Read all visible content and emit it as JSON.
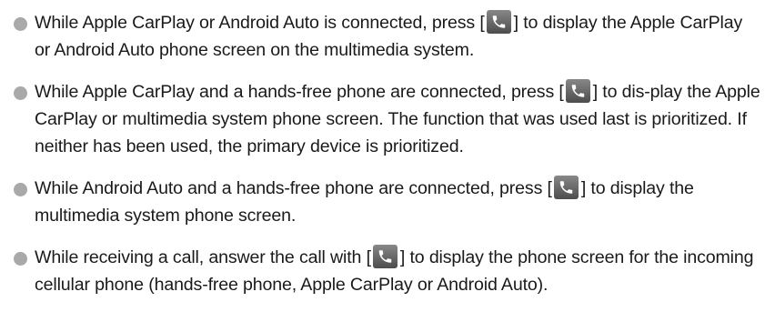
{
  "items": [
    {
      "before": "While Apple CarPlay or Android Auto is connected, press [",
      "after": "] to display the Apple CarPlay or Android Auto phone screen on the multimedia system."
    },
    {
      "before": "While Apple CarPlay and a hands-free phone are connected, press [",
      "after": "] to dis-play the Apple CarPlay or multimedia system phone screen. The function that was used last is prioritized. If neither has been used, the primary device is prioritized."
    },
    {
      "before": "While Android Auto and a hands-free phone are connected, press [",
      "after": "] to display the multimedia system phone screen."
    },
    {
      "before": "While receiving a call, answer the call with [",
      "after": "] to display the phone screen for the incoming cellular phone (hands-free phone, Apple CarPlay or Android Auto)."
    }
  ],
  "icons": {
    "bullet": "bullet-dot",
    "phone_key": "phone-handset-icon",
    "bullet_color": "#a9a9a9",
    "key_color": "#5a5a5a"
  }
}
